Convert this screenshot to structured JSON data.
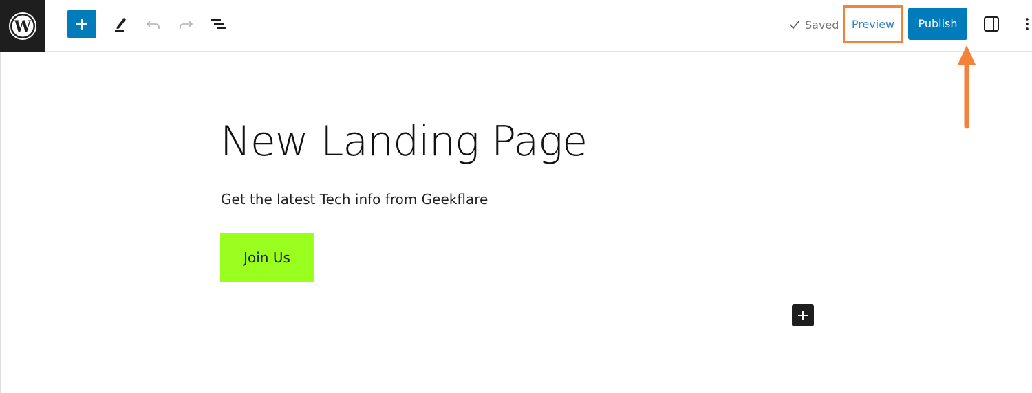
{
  "header": {
    "logo_icon": "wordpress-logo-icon",
    "toolbar": {
      "inserter_icon": "plus-icon",
      "tools_icon": "pencil-icon",
      "undo_icon": "undo-icon",
      "redo_icon": "redo-icon",
      "list_view_icon": "list-view-icon"
    },
    "saved_label": "Saved",
    "preview_label": "Preview",
    "publish_label": "Publish",
    "settings_icon": "sidebar-toggle-icon",
    "options_icon": "more-vertical-icon"
  },
  "content": {
    "title": "New Landing Page",
    "paragraph": "Get the latest Tech info from Geekflare",
    "button_label": "Join Us",
    "button_color": "#9afe1f"
  },
  "annotation": {
    "highlight_color": "#f5823a",
    "arrow_target": "Publish"
  },
  "colors": {
    "accent": "#007cba",
    "logo_bg": "#1e1e1e"
  }
}
